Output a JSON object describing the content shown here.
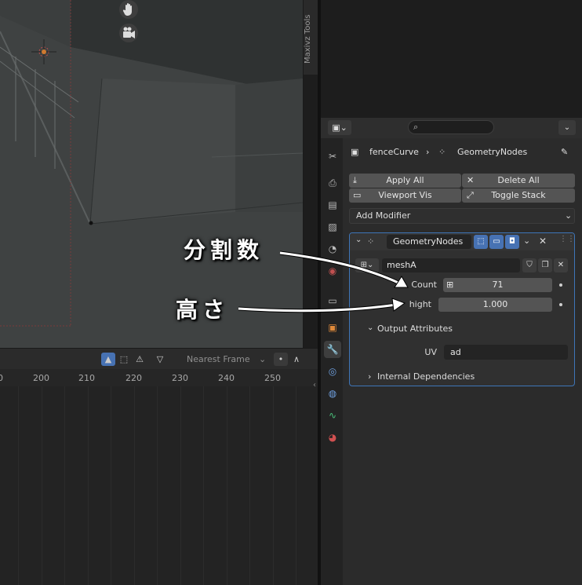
{
  "viewport": {
    "tools_tab_label": "Maxivz Tools"
  },
  "timeline": {
    "frame_mode": "Nearest Frame",
    "ticks": [
      "0",
      "200",
      "210",
      "220",
      "230",
      "240",
      "250"
    ]
  },
  "properties": {
    "breadcrumb": {
      "object": "fenceCurve",
      "modifier": "GeometryNodes"
    },
    "buttons": {
      "apply_all": "Apply All",
      "delete_all": "Delete All",
      "viewport_vis": "Viewport Vis",
      "toggle_stack": "Toggle Stack"
    },
    "add_modifier": "Add Modifier",
    "modifier": {
      "name": "GeometryNodes",
      "node_group": "meshA",
      "inputs": [
        {
          "label": "Count",
          "value": "71"
        },
        {
          "label": "hight",
          "value": "1.000"
        }
      ],
      "output_attributes_label": "Output Attributes",
      "uv_label": "UV",
      "uv_value": "ad",
      "internal_dependencies_label": "Internal Dependencies"
    }
  },
  "annotations": {
    "divisions": "分割数",
    "height": "高さ"
  },
  "colors": {
    "accent": "#4772b3",
    "panel_border": "#3e75b8",
    "panel_bg": "#2b2b2b"
  }
}
